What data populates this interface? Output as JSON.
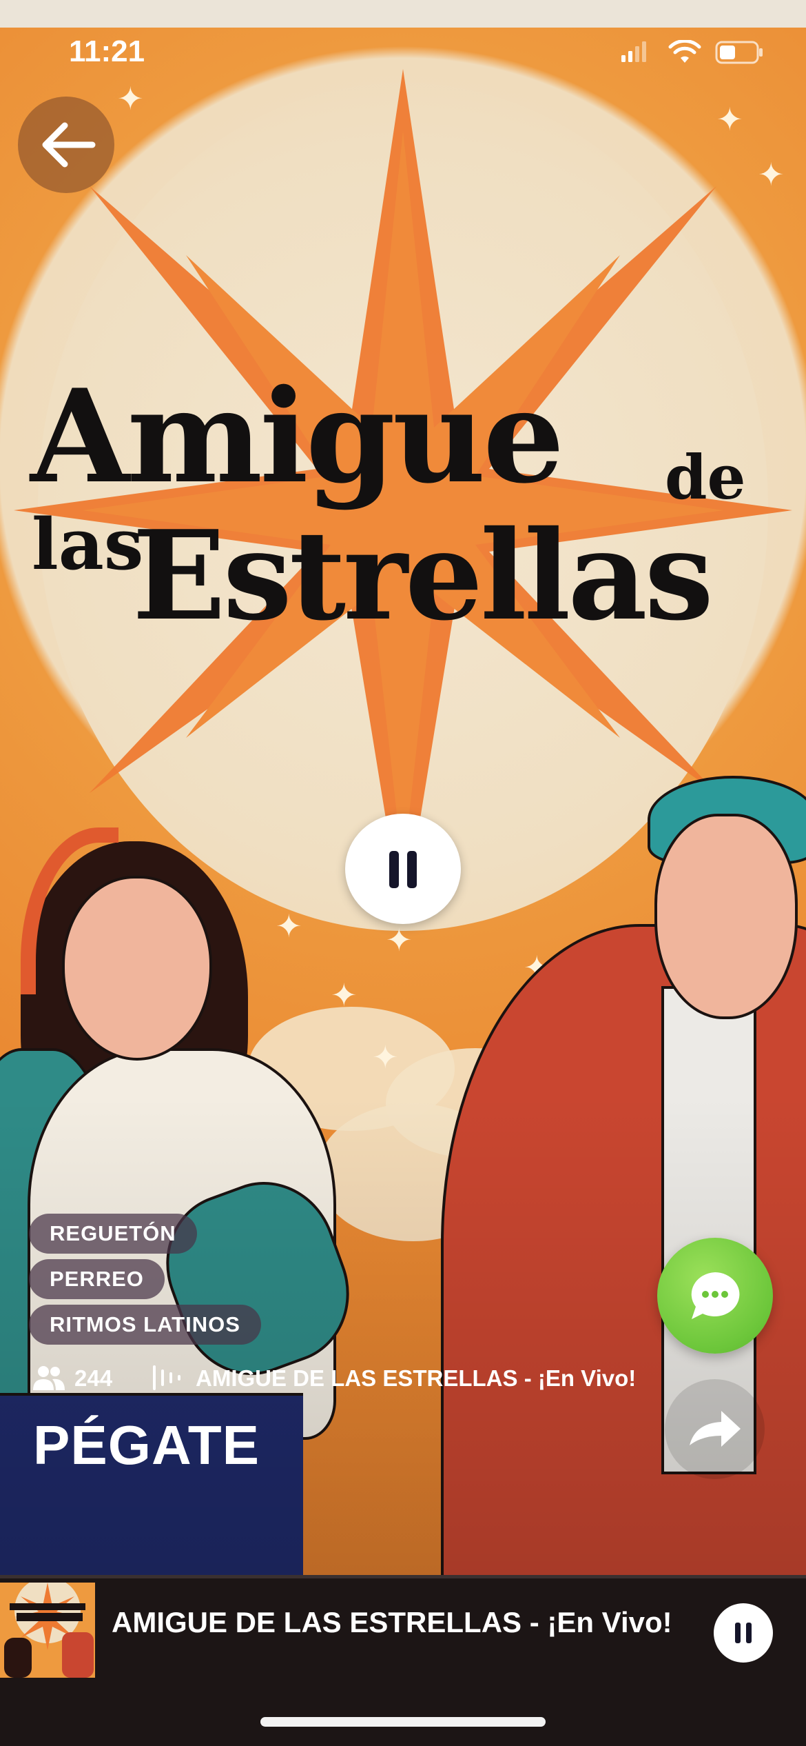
{
  "status_bar": {
    "time": "11:21"
  },
  "poster": {
    "title_line1": "Amigue",
    "title_de": "de",
    "title_las": "las",
    "title_estrellas": "Estrellas"
  },
  "tags": [
    "REGUETÓN",
    "PERREO",
    "RITMOS LATINOS"
  ],
  "listeners": "244",
  "live_title": "AMIGUE DE LAS ESTRELLAS - ¡En Vivo!",
  "now_playing_title": "PÉGATE",
  "mini_player": {
    "title": "AMIGUE DE LAS ESTRELLAS - ¡En Vivo!"
  },
  "playback": {
    "state": "playing"
  },
  "icons": {
    "back": "back-arrow-icon",
    "pause": "pause-icon",
    "chat": "chat-icon",
    "share": "share-icon",
    "listeners": "people-icon",
    "live": "audio-wave-icon"
  },
  "colors": {
    "accent_chat": "#6cc63a",
    "poster_orange": "#ea8a33",
    "mini_player_bg": "#1c1515"
  }
}
